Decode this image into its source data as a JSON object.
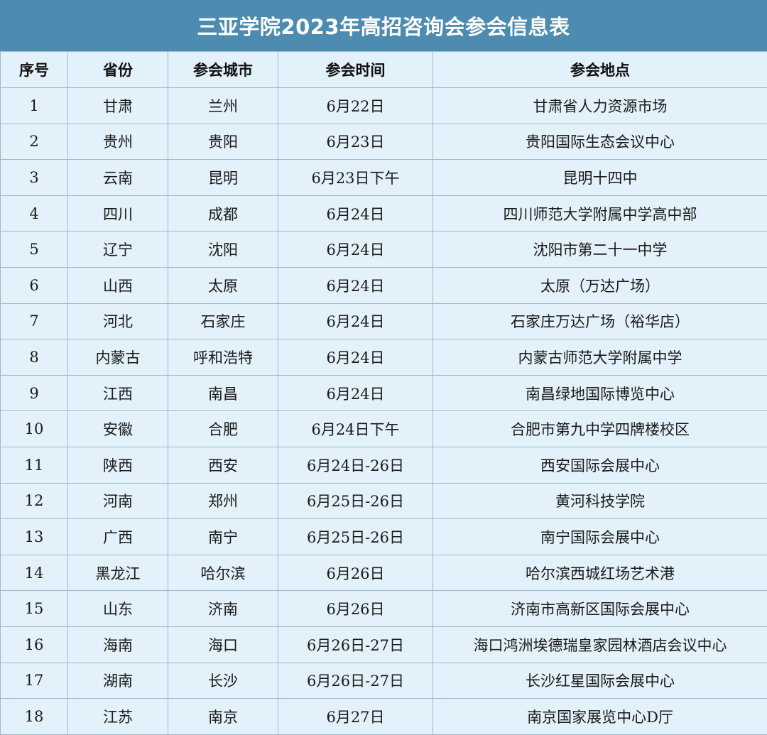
{
  "title": "三亚学院2023年高招咨询会参会信息表",
  "headers": {
    "index": "序号",
    "province": "省份",
    "city": "参会城市",
    "time": "参会时间",
    "place": "参会地点"
  },
  "rows": [
    {
      "index": "1",
      "province": "甘肃",
      "city": "兰州",
      "time": "6月22日",
      "place": "甘肃省人力资源市场"
    },
    {
      "index": "2",
      "province": "贵州",
      "city": "贵阳",
      "time": "6月23日",
      "place": "贵阳国际生态会议中心"
    },
    {
      "index": "3",
      "province": "云南",
      "city": "昆明",
      "time": "6月23日下午",
      "place": "昆明十四中"
    },
    {
      "index": "4",
      "province": "四川",
      "city": "成都",
      "time": "6月24日",
      "place": "四川师范大学附属中学高中部"
    },
    {
      "index": "5",
      "province": "辽宁",
      "city": "沈阳",
      "time": "6月24日",
      "place": "沈阳市第二十一中学"
    },
    {
      "index": "6",
      "province": "山西",
      "city": "太原",
      "time": "6月24日",
      "place": "太原（万达广场）"
    },
    {
      "index": "7",
      "province": "河北",
      "city": "石家庄",
      "time": "6月24日",
      "place": "石家庄万达广场（裕华店）"
    },
    {
      "index": "8",
      "province": "内蒙古",
      "city": "呼和浩特",
      "time": "6月24日",
      "place": "内蒙古师范大学附属中学"
    },
    {
      "index": "9",
      "province": "江西",
      "city": "南昌",
      "time": "6月24日",
      "place": "南昌绿地国际博览中心"
    },
    {
      "index": "10",
      "province": "安徽",
      "city": "合肥",
      "time": "6月24日下午",
      "place": "合肥市第九中学四牌楼校区"
    },
    {
      "index": "11",
      "province": "陕西",
      "city": "西安",
      "time": "6月24日-26日",
      "place": "西安国际会展中心"
    },
    {
      "index": "12",
      "province": "河南",
      "city": "郑州",
      "time": "6月25日-26日",
      "place": "黄河科技学院"
    },
    {
      "index": "13",
      "province": "广西",
      "city": "南宁",
      "time": "6月25日-26日",
      "place": "南宁国际会展中心"
    },
    {
      "index": "14",
      "province": "黑龙江",
      "city": "哈尔滨",
      "time": "6月26日",
      "place": "哈尔滨西城红场艺术港"
    },
    {
      "index": "15",
      "province": "山东",
      "city": "济南",
      "time": "6月26日",
      "place": "济南市高新区国际会展中心"
    },
    {
      "index": "16",
      "province": "海南",
      "city": "海口",
      "time": "6月26日-27日",
      "place": "海口鸿洲埃德瑞皇家园林酒店会议中心"
    },
    {
      "index": "17",
      "province": "湖南",
      "city": "长沙",
      "time": "6月26日-27日",
      "place": "长沙红星国际会展中心"
    },
    {
      "index": "18",
      "province": "江苏",
      "city": "南京",
      "time": "6月27日",
      "place": "南京国家展览中心D厅"
    }
  ],
  "colors": {
    "title_bg": "#4d8bb0",
    "cell_bg": "#e3f1fa",
    "border": "#9cb9cc"
  }
}
